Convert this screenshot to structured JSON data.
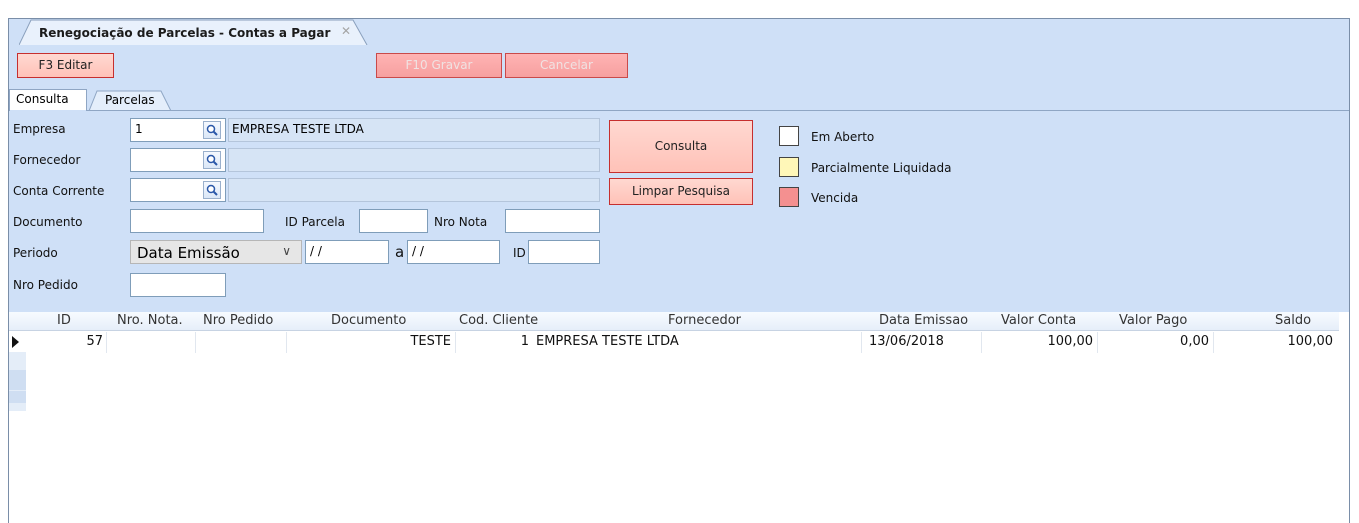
{
  "document_tab": {
    "title": "Renegociação de Parcelas - Contas a Pagar",
    "close_glyph": "✕"
  },
  "toolbar": {
    "edit_label": "F3 Editar",
    "save_label": "F10 Gravar",
    "cancel_label": "Cancelar"
  },
  "tabs": [
    {
      "label": "Consulta"
    },
    {
      "label": "Parcelas"
    }
  ],
  "form": {
    "empresa": {
      "label": "Empresa",
      "code": "1",
      "name": "EMPRESA TESTE LTDA"
    },
    "fornecedor": {
      "label": "Fornecedor",
      "code": "",
      "name": ""
    },
    "conta_corrente": {
      "label": "Conta Corrente",
      "code": "",
      "name": ""
    },
    "documento": {
      "label": "Documento",
      "value": ""
    },
    "id_parcela": {
      "label": "ID Parcela",
      "value": ""
    },
    "nro_nota": {
      "label": "Nro Nota",
      "value": ""
    },
    "periodo": {
      "label": "Periodo",
      "type_selected": "Data Emissão",
      "from": " / /",
      "separator": "a",
      "to": " / /"
    },
    "id": {
      "label": "ID",
      "value": ""
    },
    "nro_pedido": {
      "label": "Nro Pedido",
      "value": ""
    }
  },
  "actions": {
    "consulta_label": "Consulta",
    "limpar_label": "Limpar Pesquisa"
  },
  "legend": [
    {
      "label": "Em Aberto",
      "color": "#ffffff"
    },
    {
      "label": "Parcialmente Liquidada",
      "color": "#fff7b8"
    },
    {
      "label": "Vencida",
      "color": "#f49090"
    }
  ],
  "grid": {
    "headers": [
      "ID",
      "Nro. Nota.",
      "Nro Pedido",
      "Documento",
      "Cod. Cliente",
      "Fornecedor",
      "Data Emissao",
      "Valor Conta",
      "Valor Pago",
      "Saldo"
    ],
    "rows": [
      {
        "id": "57",
        "nro_nota": "",
        "nro_pedido": "",
        "documento": "TESTE",
        "cod_cliente": "1",
        "fornecedor": "EMPRESA TESTE LTDA",
        "data_emissao": "13/06/2018",
        "valor_conta": "100,00",
        "valor_pago": "0,00",
        "saldo": "100,00"
      }
    ]
  },
  "colors": {
    "accent_band": "#cfe0f7",
    "button_red_border": "#c62f2f"
  }
}
